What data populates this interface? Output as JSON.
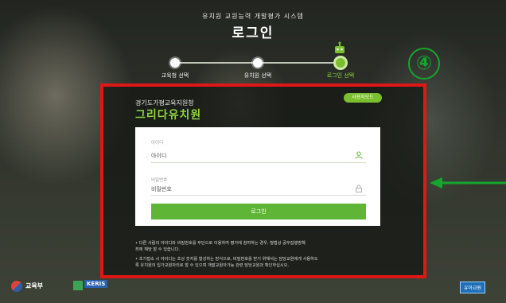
{
  "header": {
    "system_title": "유치원 교원능력 개발평가 시스템",
    "page_title": "로그인"
  },
  "steps": [
    {
      "label": "교육청 선택",
      "active": false
    },
    {
      "label": "유치원 선택",
      "active": false
    },
    {
      "label": "로그인 선택",
      "active": true
    }
  ],
  "annotation": {
    "badge": "④"
  },
  "school": {
    "org": "경기도가평교육지원청",
    "name": "그리다유치원",
    "change_button": "사용자모드"
  },
  "form": {
    "id_label": "아이디",
    "id_value": "아이디",
    "password_label": "비밀번호",
    "password_value": "비밀번호",
    "login_button": "로그인"
  },
  "notices": [
    "• 다른 사람의 아이디와 비밀번호를 무단으로 이용하여 평가에 참여하는 경우, 형법상 공무집행방해",
    "죄에 해당 할 수 있습니다.",
    "• 초기접속 시 아이디는 초상 숫자를 형성하는 방식으로, 비밀번호를 받기 위해서는 담당교원에게 사용하도",
    "록 유치원의 입가교원자리로 할 수 있으며 개발교원아가능 관련 담당교원과 확인하십시오."
  ],
  "footer": {
    "ministry": "교육부",
    "keris": "KERIS",
    "right_logo": "유아교원"
  },
  "colors": {
    "accent_green": "#7bbf2f",
    "highlight_red": "#e01717",
    "annotation_green": "#16a52f"
  }
}
